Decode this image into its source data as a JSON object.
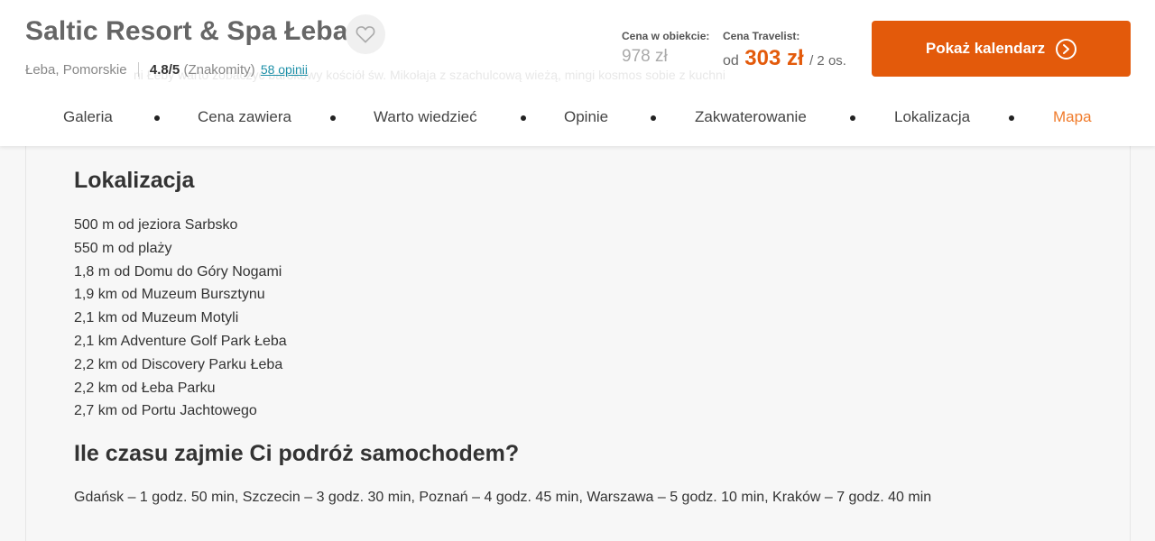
{
  "header": {
    "title": "Saltic Resort & Spa Łeba",
    "location": "Łeba, Pomorskie",
    "rating": "4.8/5",
    "rating_text": "(Znakomity)",
    "reviews_link": "58 opinii",
    "background_text": "ni Łeby warto zobaczyć barokowy kościół św. Mikołaja z szachulcową wieżą, mingi kosmos sobie z kuchni"
  },
  "price": {
    "object_label": "Cena w obiekcie:",
    "object_value": "978 zł",
    "travelist_label": "Cena Travelist:",
    "from": "od",
    "travelist_value": "303 zł",
    "per": "/ 2 os."
  },
  "cta": {
    "label": "Pokaż kalendarz",
    "icon": "chevron-right-circle-icon"
  },
  "nav": {
    "items": [
      {
        "label": "Galeria"
      },
      {
        "label": "Cena zawiera"
      },
      {
        "label": "Warto wiedzieć"
      },
      {
        "label": "Opinie"
      },
      {
        "label": "Zakwaterowanie"
      },
      {
        "label": "Lokalizacja"
      },
      {
        "label": "Mapa"
      }
    ],
    "active": "Mapa"
  },
  "content": {
    "location_heading": "Lokalizacja",
    "locations": [
      "500 m od jeziora Sarbsko",
      "550 m od plaży",
      "1,8 m od Domu do Góry Nogami",
      "1,9 km od Muzeum Bursztynu",
      "2,1 km od Muzeum Motyli",
      "2,1 km Adventure Golf Park Łeba",
      "2,2 km od Discovery Parku Łeba",
      "2,2 km od Łeba Parku",
      "2,7 km od Portu Jachtowego"
    ],
    "travel_heading": "Ile czasu zajmie Ci podróż samochodem?",
    "travel_times": "Gdańsk – 1 godz. 50 min, Szczecin – 3 godz. 30 min, Poznań – 4 godz. 45 min, Warszawa – 5 godz. 10 min, Kraków – 7 godz. 40 min"
  },
  "colors": {
    "accent": "#e35a0b",
    "active_nav": "#f07b2b",
    "link": "#1e90a8"
  }
}
